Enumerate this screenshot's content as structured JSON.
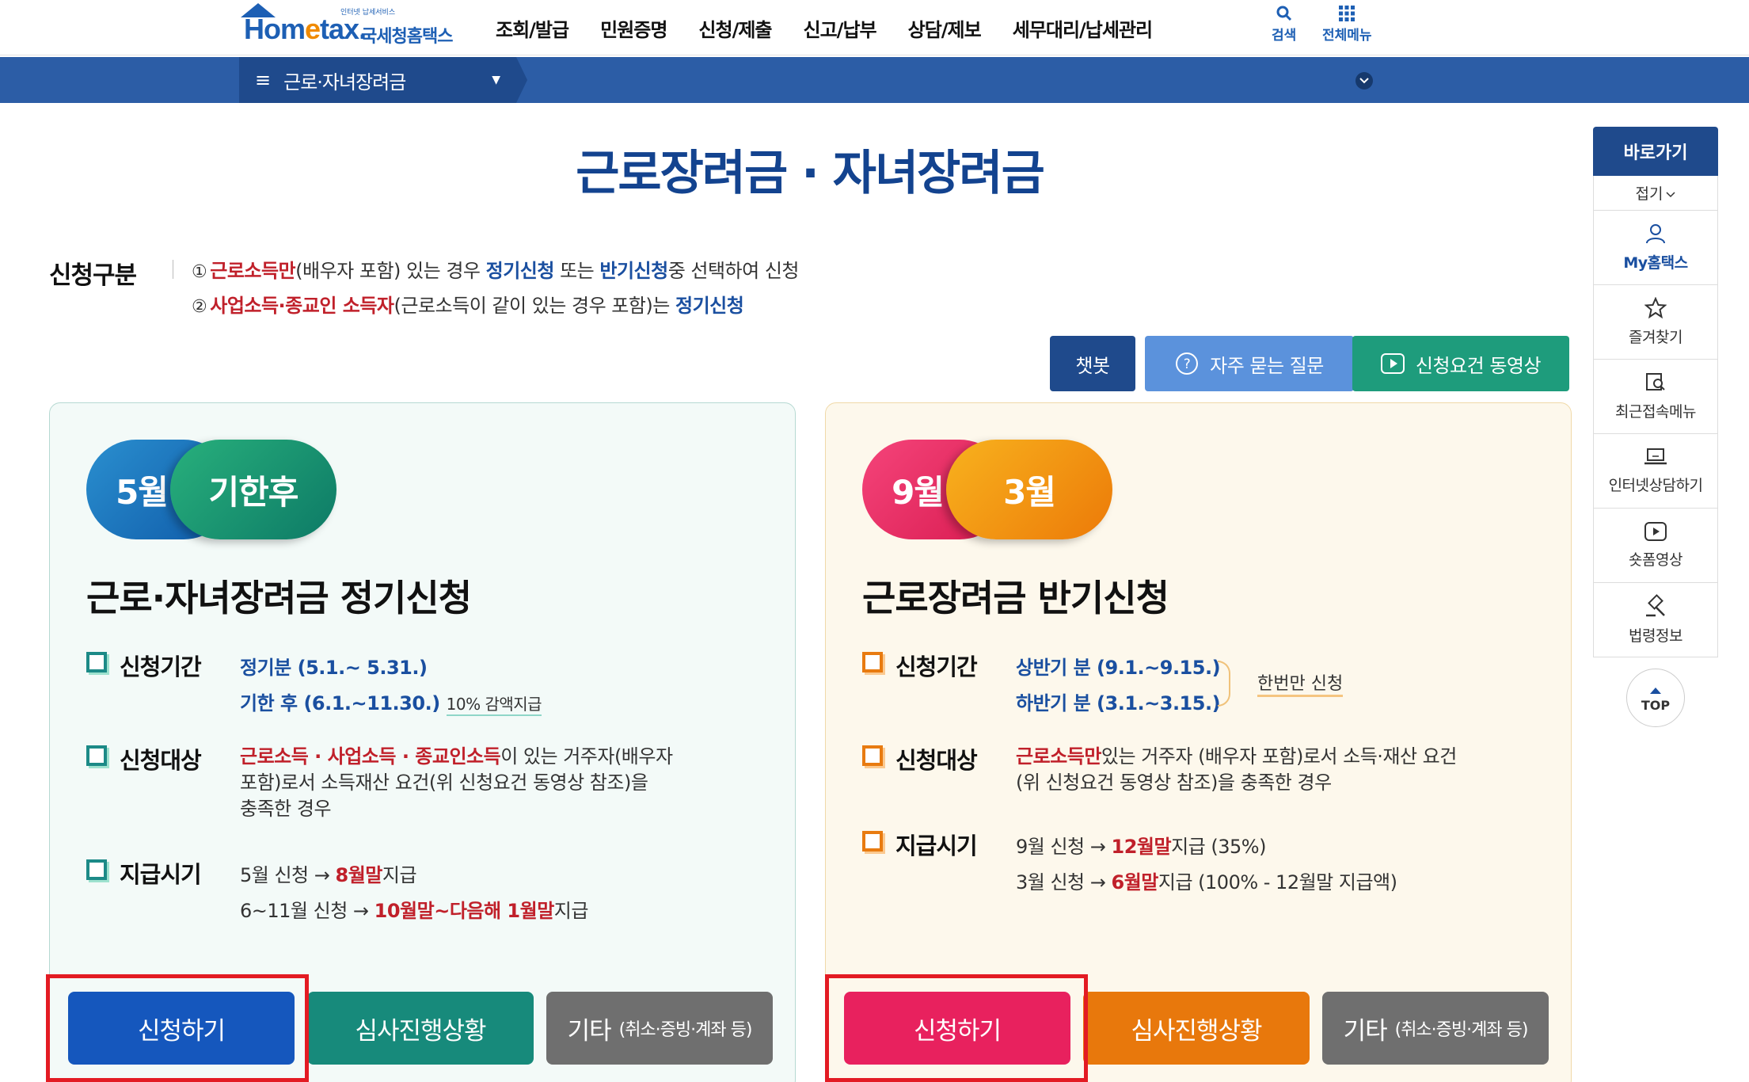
{
  "header": {
    "logo_tagline": "인터넷 납세서비스",
    "logo_text_a": "Hom",
    "logo_text_e": "e",
    "logo_text_b": "tax.",
    "logo_text_kr": "국세청홈택스",
    "nav": [
      "조회/발급",
      "민원증명",
      "신청/제출",
      "신고/납부",
      "상담/제보",
      "세무대리/납세관리"
    ],
    "search_label": "검색",
    "allmenu_label": "전체메뉴"
  },
  "subbar": {
    "menu_icon": "≡",
    "breadcrumb": "근로·자녀장려금"
  },
  "page": {
    "title": "근로장려금 · 자녀장려금",
    "section_label": "신청구분",
    "line1": {
      "num": "①",
      "a": "근로소득만",
      "b": "(배우자 포함) 있는 경우 ",
      "c": "정기신청",
      "d": " 또는 ",
      "e": "반기신청",
      "f": "중 선택하여 신청"
    },
    "line2": {
      "num": "②",
      "a": "사업소득·종교인 소득자",
      "b": "(근로소득이 같이 있는 경우 포함)는 ",
      "c": "정기신청"
    }
  },
  "actions": {
    "chatbot": "챗봇",
    "faq": "자주 묻는 질문",
    "video": "신청요건 동영상"
  },
  "colors": {
    "brand_blue": "#1d5fb4",
    "navy": "#1f4a8c",
    "teal": "#1c8a87",
    "pink": "#e91e5a",
    "orange": "#e87b10",
    "highlight_red": "#e31b23"
  },
  "left_card": {
    "pill1": "5월",
    "pill2": "기한후",
    "title": "근로·자녀장려금 정기신청",
    "period_label": "신청기간",
    "period_l1_a": "정기분 (5.1.~ 5.31.)",
    "period_l2_a": "기한 후 (6.1.~11.30.)",
    "period_note": "10% 감액지급",
    "target_label": "신청대상",
    "target_red": "근로소득 · 사업소득 · 종교인소득",
    "target_l1": "이 있는 거주자(배우자",
    "target_l2": "포함)로서 소득재산 요건(위 신청요건 동영상 참조)을",
    "target_l3": "충족한 경우",
    "pay_label": "지급시기",
    "pay_l1_a": "5월 신청 → ",
    "pay_l1_red": "8월말",
    "pay_l1_b": "지급",
    "pay_l2_a": "6~11월 신청 → ",
    "pay_l2_red": "10월말~다음해 1월말",
    "pay_l2_b": "지급",
    "btn_apply": "신청하기",
    "btn_status": "심사진행상황",
    "btn_etc": "기타",
    "btn_etc_small": "(취소·증빙·계좌 등)"
  },
  "right_card": {
    "pill1": "9월",
    "pill2": "3월",
    "title": "근로장려금 반기신청",
    "period_label": "신청기간",
    "period_l1": "상반기 분 (9.1.~9.15.)",
    "period_l2": "하반기 분 (3.1.~3.15.)",
    "once_note": "한번만 신청",
    "target_label": "신청대상",
    "target_red": "근로소득만",
    "target_l1": "있는 거주자 (배우자 포함)로서 소득·재산 요건",
    "target_l2": "(위 신청요건 동영상 참조)을 충족한 경우",
    "pay_label": "지급시기",
    "pay_l1_a": "9월 신청 → ",
    "pay_l1_red": "12월말",
    "pay_l1_b": "지급 (35%)",
    "pay_l2_a": "3월 신청 → ",
    "pay_l2_red": "6월말",
    "pay_l2_b": "지급 (100% - 12월말 지급액)",
    "btn_apply": "신청하기",
    "btn_status": "심사진행상황",
    "btn_etc": "기타",
    "btn_etc_small": "(취소·증빙·계좌 등)"
  },
  "quick_panel": {
    "title": "바로가기",
    "fold": "접기",
    "items": [
      "My홈택스",
      "즐겨찾기",
      "최근접속메뉴",
      "인터넷상담하기",
      "숏폼영상",
      "법령정보"
    ],
    "top": "TOP"
  }
}
